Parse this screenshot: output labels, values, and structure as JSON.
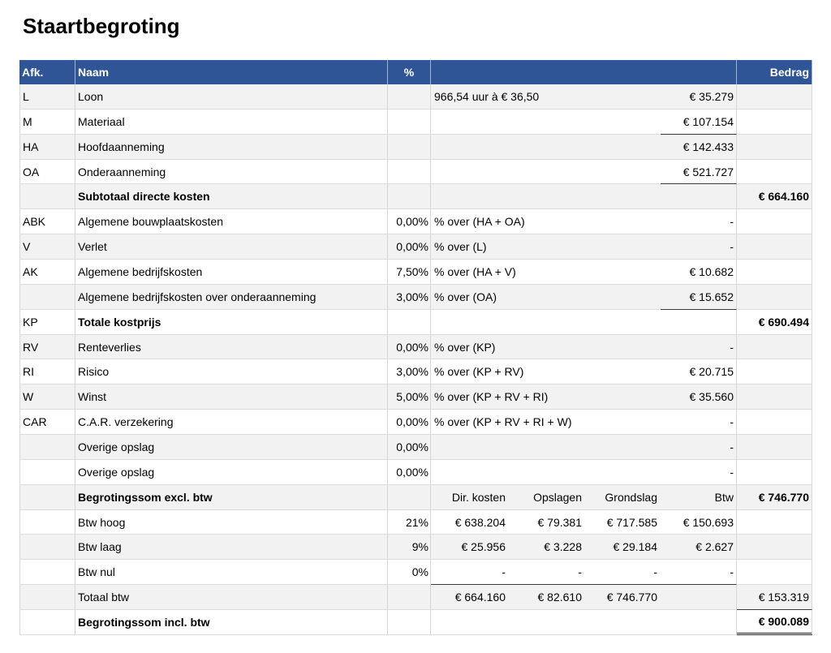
{
  "title": "Staartbegroting",
  "colors": {
    "header_bg": "#2F5597",
    "header_text": "#FFFFFF",
    "row_alt": "#F2F2F2"
  },
  "header": {
    "afk": "Afk.",
    "naam": "Naam",
    "pct": "%",
    "bedrag": "Bedrag"
  },
  "rows": [
    {
      "afk": "L",
      "naam": "Loon",
      "omschrijving": "966,54 uur à € 36,50",
      "deelbedrag": "€ 35.279"
    },
    {
      "afk": "M",
      "naam": "Materiaal",
      "deelbedrag": "€ 107.154"
    },
    {
      "afk": "HA",
      "naam": "Hoofdaanneming",
      "deelbedrag": "€ 142.433"
    },
    {
      "afk": "OA",
      "naam": "Onderaanneming",
      "deelbedrag": "€ 521.727"
    },
    {
      "naam": "Subtotaal directe kosten",
      "bedrag": "€ 664.160"
    },
    {
      "afk": "ABK",
      "naam": "Algemene bouwplaatskosten",
      "pct": "0,00%",
      "omschrijving": "% over (HA + OA)",
      "deelbedrag": "-"
    },
    {
      "afk": "V",
      "naam": "Verlet",
      "pct": "0,00%",
      "omschrijving": "% over (L)",
      "deelbedrag": "-"
    },
    {
      "afk": "AK",
      "naam": "Algemene bedrijfskosten",
      "pct": "7,50%",
      "omschrijving": "% over (HA + V)",
      "deelbedrag": "€ 10.682"
    },
    {
      "naam": "Algemene bedrijfskosten over onderaanneming",
      "pct": "3,00%",
      "omschrijving": "% over (OA)",
      "deelbedrag": "€ 15.652"
    },
    {
      "afk": "KP",
      "naam": "Totale kostprijs",
      "bedrag": "€ 690.494"
    },
    {
      "afk": "RV",
      "naam": "Renteverlies",
      "pct": "0,00%",
      "omschrijving": "% over (KP)",
      "deelbedrag": "-"
    },
    {
      "afk": "RI",
      "naam": "Risico",
      "pct": "3,00%",
      "omschrijving": "% over (KP + RV)",
      "deelbedrag": "€ 20.715"
    },
    {
      "afk": "W",
      "naam": "Winst",
      "pct": "5,00%",
      "omschrijving": "% over (KP + RV + RI)",
      "deelbedrag": "€ 35.560"
    },
    {
      "afk": "CAR",
      "naam": "C.A.R. verzekering",
      "pct": "0,00%",
      "omschrijving": "% over (KP + RV + RI + W)",
      "deelbedrag": "-"
    },
    {
      "naam": "Overige opslag",
      "pct": "0,00%",
      "deelbedrag": "-"
    },
    {
      "naam": "Overige opslag",
      "pct": "0,00%",
      "deelbedrag": "-"
    }
  ],
  "btw": {
    "excl": {
      "naam": "Begrotingssom excl. btw",
      "columns": [
        "Dir. kosten",
        "Opslagen",
        "Grondslag",
        "Btw"
      ],
      "bedrag": "€ 746.770"
    },
    "rows": [
      {
        "naam": "Btw hoog",
        "pct": "21%",
        "values": [
          "€ 638.204",
          "€ 79.381",
          "€ 717.585",
          "€ 150.693"
        ]
      },
      {
        "naam": "Btw laag",
        "pct": "9%",
        "values": [
          "€ 25.956",
          "€ 3.228",
          "€ 29.184",
          "€ 2.627"
        ]
      },
      {
        "naam": "Btw nul",
        "pct": "0%",
        "values": [
          "-",
          "-",
          "-",
          "-"
        ]
      }
    ],
    "totaal": {
      "naam": "Totaal btw",
      "values": [
        "€ 664.160",
        "€ 82.610",
        "€ 746.770"
      ],
      "bedrag": "€ 153.319"
    },
    "incl": {
      "naam": "Begrotingssom incl. btw",
      "bedrag": "€ 900.089"
    }
  }
}
